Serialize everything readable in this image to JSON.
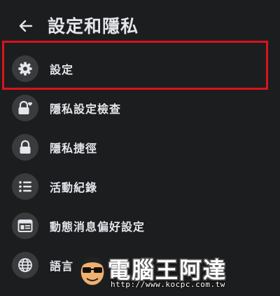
{
  "header": {
    "title": "設定和隱私",
    "back_icon": "arrow-left-icon"
  },
  "menu": {
    "items": [
      {
        "label": "設定",
        "icon": "gear-icon"
      },
      {
        "label": "隱私設定檢查",
        "icon": "lock-heart-icon"
      },
      {
        "label": "隱私捷徑",
        "icon": "lock-icon"
      },
      {
        "label": "活動紀錄",
        "icon": "list-icon"
      },
      {
        "label": "動態消息偏好設定",
        "icon": "news-feed-icon"
      },
      {
        "label": "語言",
        "icon": "globe-icon"
      }
    ]
  },
  "highlight": {
    "color": "#d9141c",
    "target": "設定"
  },
  "watermark": {
    "title": "電腦王阿達",
    "url": "http://www.kocpc.com.tw"
  },
  "colors": {
    "background": "#1c1d1f",
    "icon_circle": "#3a3b3c",
    "text": "#e4e6eb"
  }
}
